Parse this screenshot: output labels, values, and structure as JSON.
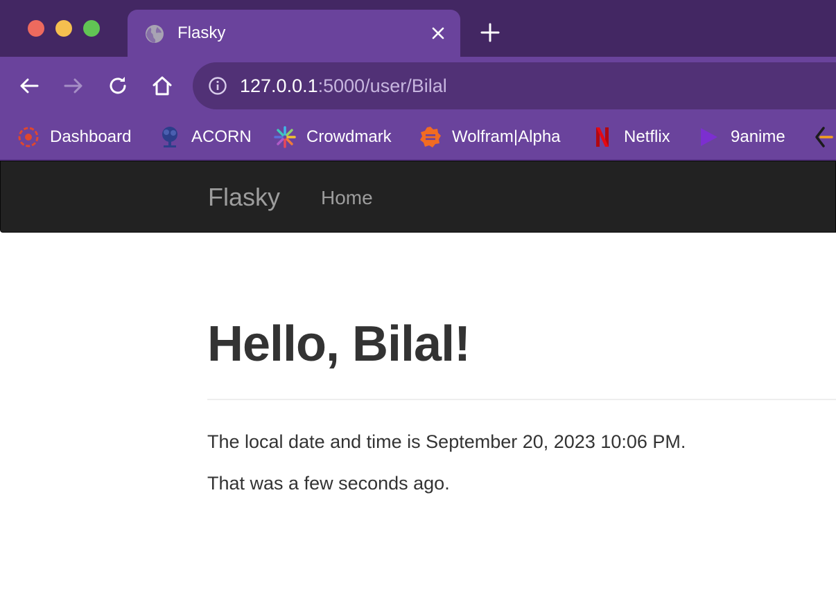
{
  "window": {
    "traffic_lights": [
      "close",
      "minimize",
      "zoom"
    ]
  },
  "tab": {
    "title": "Flasky",
    "icon": "globe-icon"
  },
  "toolbar": {
    "url_host": "127.0.0.1",
    "url_rest": ":5000/user/Bilal"
  },
  "bookmarks": [
    {
      "label": "Dashboard",
      "icon": "dashboard-icon"
    },
    {
      "label": "ACORN",
      "icon": "acorn-icon"
    },
    {
      "label": "Crowdmark",
      "icon": "crowdmark-icon"
    },
    {
      "label": "Wolfram|Alpha",
      "icon": "wolfram-icon"
    },
    {
      "label": "Netflix",
      "icon": "netflix-icon"
    },
    {
      "label": "9anime",
      "icon": "9anime-icon"
    }
  ],
  "navbar": {
    "brand": "Flasky",
    "home": "Home"
  },
  "page": {
    "heading": "Hello, Bilal!",
    "datetime_text": "The local date and time is September 20, 2023 10:06 PM.",
    "relative_text": "That was a few seconds ago."
  },
  "colors": {
    "chrome_dark": "#432763",
    "chrome": "#6a439c",
    "navbar_bg": "#222222",
    "text": "#333333"
  }
}
